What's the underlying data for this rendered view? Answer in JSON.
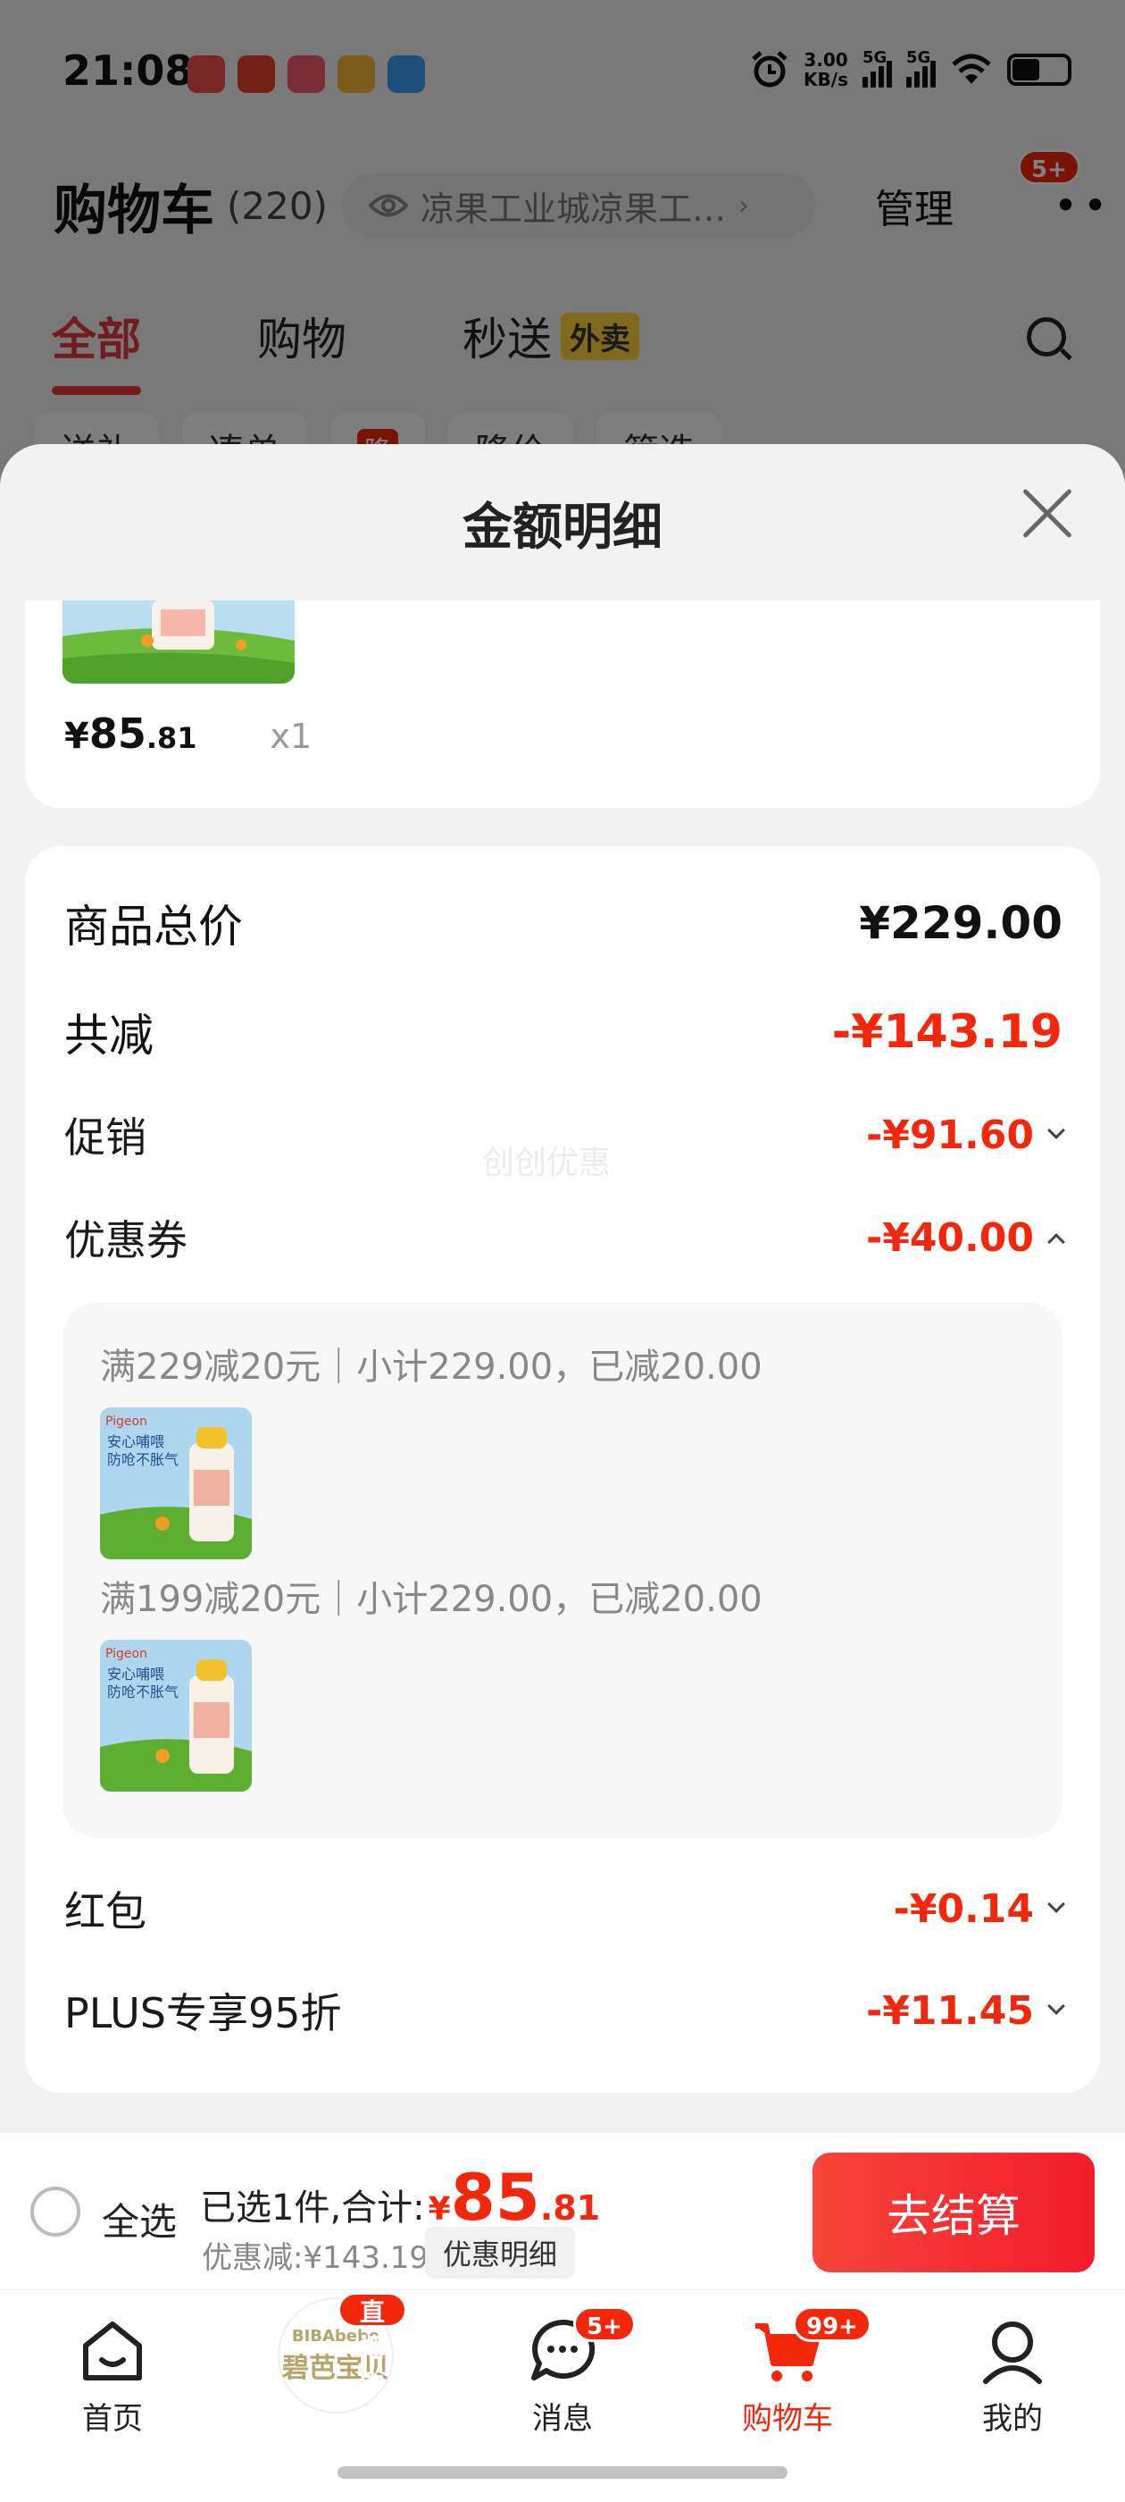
{
  "status_bar": {
    "time": "21:08",
    "net_speed_top": "3.00",
    "net_speed_bottom": "KB/s",
    "sim1": "5G",
    "sim2": "5G"
  },
  "header": {
    "title": "购物车",
    "count": "(220)",
    "address": "凉果工业城凉果工…",
    "manage": "管理",
    "more_badge": "5+"
  },
  "tabs": [
    {
      "label": "全部"
    },
    {
      "label": "购物"
    },
    {
      "label": "秒送"
    }
  ],
  "tab_tag": "外卖",
  "chips": [
    "送礼",
    "凑单",
    "降",
    "降价",
    "筛选"
  ],
  "sheet": {
    "title": "金额明细",
    "item_price_yen": "¥",
    "item_price_int": "85",
    "item_price_dec": ".81",
    "item_qty": "x1",
    "rows": {
      "total_label": "商品总价",
      "total_value": "¥229.00",
      "reduce_label": "共减",
      "reduce_value": "-¥143.19",
      "promo_label": "促销",
      "promo_value": "-¥91.60",
      "coupon_label": "优惠券",
      "coupon_value": "-¥40.00",
      "redpacket_label": "红包",
      "redpacket_value": "-¥0.14",
      "plus_label": "PLUS专享95折",
      "plus_value": "-¥11.45"
    },
    "watermark": "创创优惠",
    "coupons": [
      {
        "text": "满229减20元｜小计229.00，已减20.00"
      },
      {
        "text": "满199减20元｜小计229.00，已减20.00"
      }
    ],
    "product_image_text": {
      "brand": "Pigeon",
      "line1": "安心哺喂",
      "line2": "防呛不胀气"
    }
  },
  "checkout": {
    "select_all": "全选",
    "selected_prefix": "已选1件,合计:",
    "yen": "¥",
    "total_int": "85",
    "total_dec": ".81",
    "discount": "优惠减:¥143.19",
    "detail_button": "优惠明细",
    "checkout_button": "去结算"
  },
  "bottom_nav": {
    "home": "首页",
    "live_badge": "直播中",
    "live_brand_top": "BIBAbebe",
    "live_brand_bottom": "碧芭宝贝",
    "messages": "消息",
    "messages_badge": "5+",
    "cart": "购物车",
    "cart_badge": "99+",
    "mine": "我的"
  },
  "colors": {
    "accent_red": "#f2270c",
    "jd_red": "#e4393c",
    "tag_yellow": "#ffd23b"
  }
}
